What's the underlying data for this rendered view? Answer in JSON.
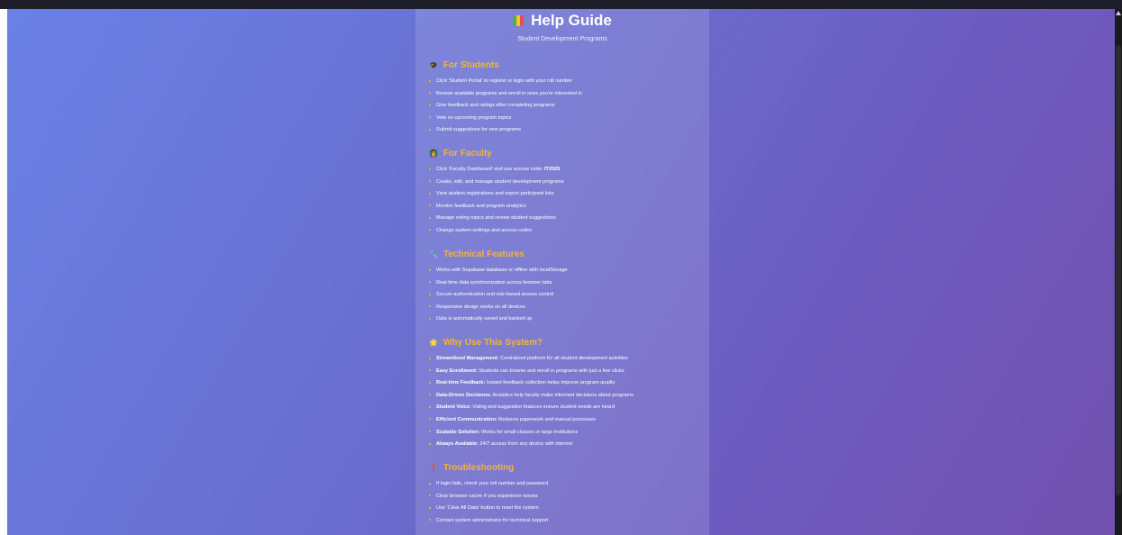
{
  "page": {
    "title": "Help Guide",
    "subtitle": "Student Development Programs"
  },
  "sections": [
    {
      "icon": "graduation-cap-icon",
      "heading": "For Students",
      "items": [
        "Click 'Student Portal' to register or login with your roll number",
        "Browse available programs and enroll in ones you're interested in",
        "Give feedback and ratings after completing programs",
        "Vote on upcoming program topics",
        "Submit suggestions for new programs"
      ]
    },
    {
      "icon": "teacher-icon",
      "heading": "For Faculty",
      "items": [
        {
          "text": "Click 'Faculty Dashboard' and use access code: ",
          "bold": "IT2025"
        },
        "Create, edit, and manage student development programs",
        "View student registrations and export participant lists",
        "Monitor feedback and program analytics",
        "Manage voting topics and review student suggestions",
        "Change system settings and access codes"
      ]
    },
    {
      "icon": "wrench-icon",
      "heading": "Technical Features",
      "items": [
        "Works with Supabase database or offline with localStorage",
        "Real-time data synchronization across browser tabs",
        "Secure authentication and role-based access control",
        "Responsive design works on all devices",
        "Data is automatically saved and backed up"
      ]
    },
    {
      "icon": "star-icon",
      "heading": "Why Use This System?",
      "items": [
        {
          "bold": "Streamlined Management:",
          "text": " Centralized platform for all student development activities"
        },
        {
          "bold": "Easy Enrollment:",
          "text": " Students can browse and enroll in programs with just a few clicks"
        },
        {
          "bold": "Real-time Feedback:",
          "text": " Instant feedback collection helps improve program quality"
        },
        {
          "bold": "Data-Driven Decisions:",
          "text": " Analytics help faculty make informed decisions about programs"
        },
        {
          "bold": "Student Voice:",
          "text": " Voting and suggestion features ensure student needs are heard"
        },
        {
          "bold": "Efficient Communication:",
          "text": " Reduces paperwork and manual processes"
        },
        {
          "bold": "Scalable Solution:",
          "text": " Works for small classes or large institutions"
        },
        {
          "bold": "Always Available:",
          "text": " 24/7 access from any device with internet"
        }
      ]
    },
    {
      "icon": "alert-icon",
      "heading": "Troubleshooting",
      "items": [
        "If login fails, check your roll number and password",
        "Clear browser cache if you experience issues",
        "Use 'Clear All Data' button to reset the system",
        "Contact system administrator for technical support"
      ]
    }
  ],
  "colors": {
    "accent": "#f4b43a",
    "background_start": "#6a80e4",
    "background_end": "#7150ae"
  }
}
